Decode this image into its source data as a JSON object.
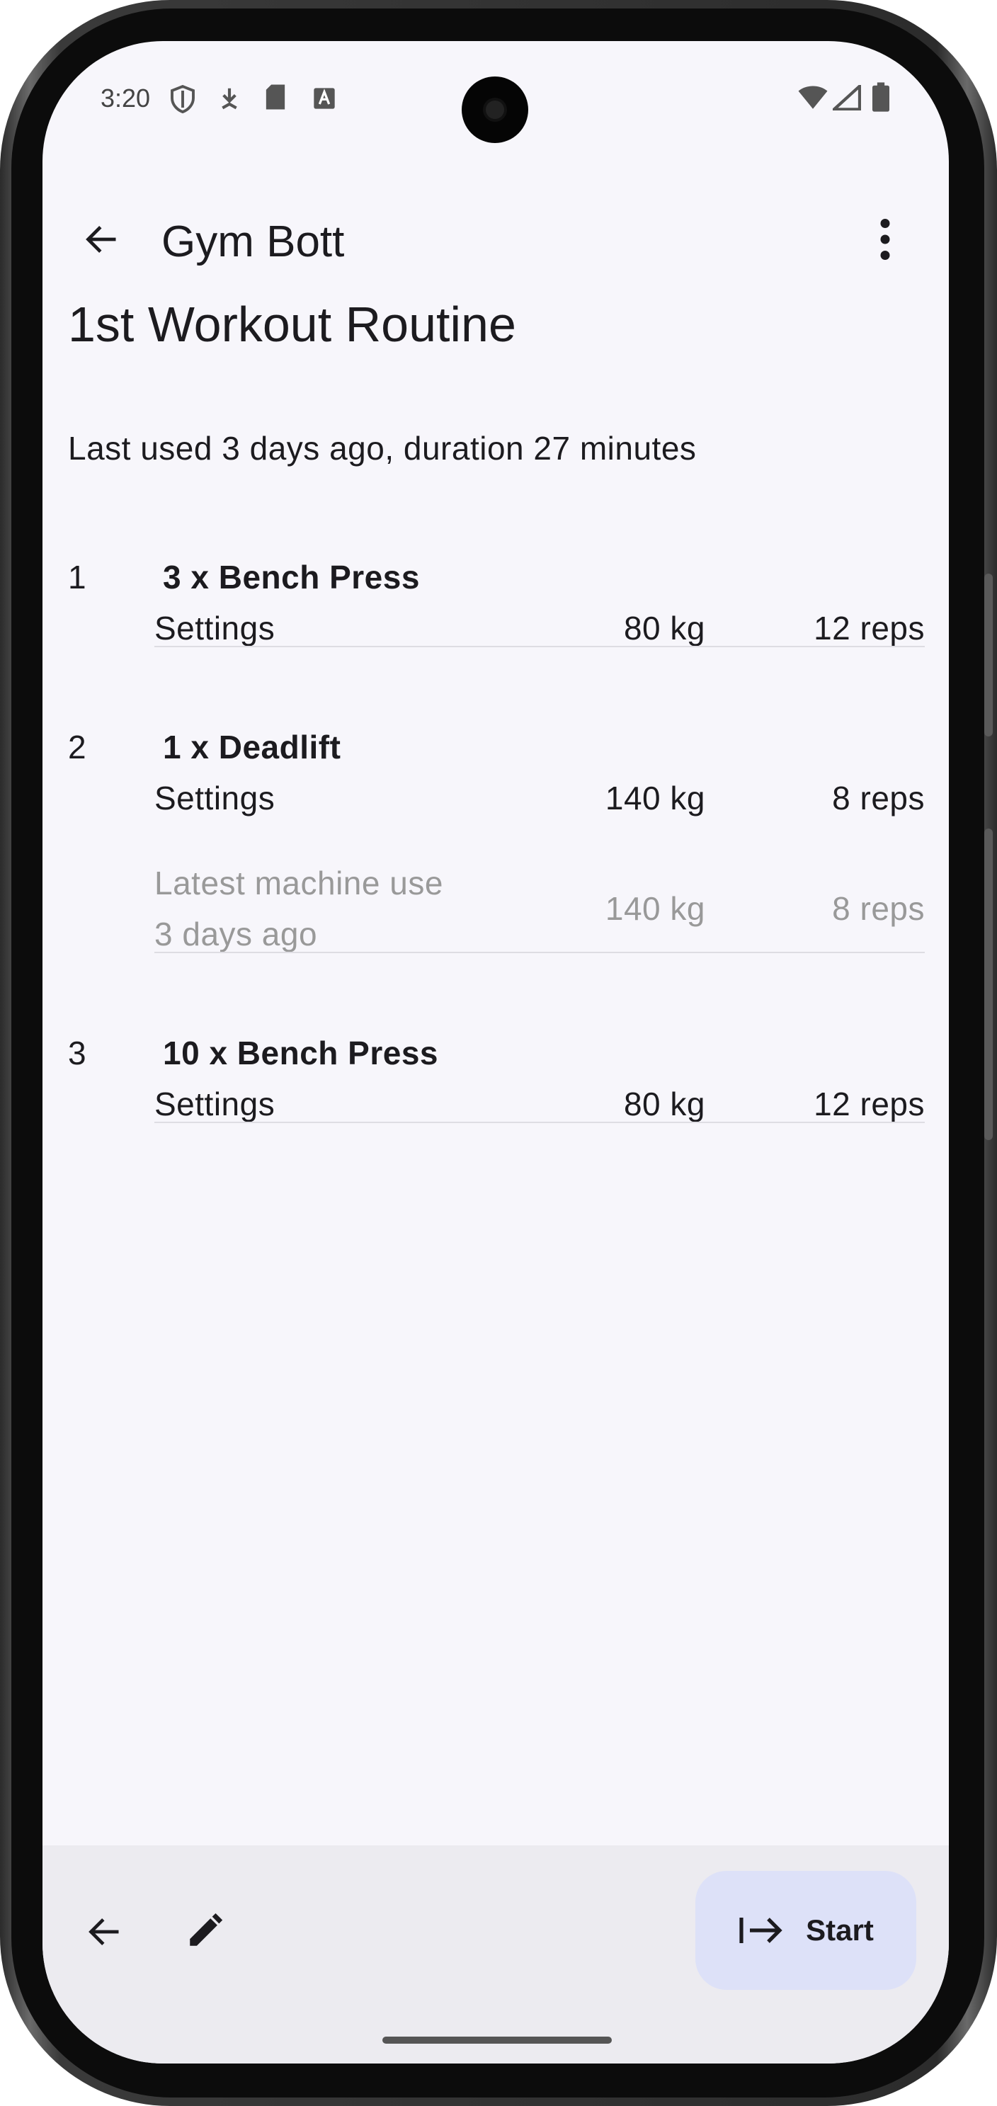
{
  "status_bar": {
    "time": "3:20",
    "left_icons": [
      "shield-icon",
      "download-icon",
      "sd-card-icon",
      "keyboard-a-icon"
    ],
    "right_icons": [
      "wifi-icon",
      "signal-icon",
      "battery-icon"
    ]
  },
  "app_bar": {
    "title": "Gym Bott",
    "back_icon": "arrow-back-icon",
    "menu_icon": "more-vert-icon"
  },
  "routine": {
    "title": "1st Workout Routine",
    "last_used": "Last used 3 days ago, duration 27 minutes"
  },
  "exercises": [
    {
      "number": "1",
      "name": "3 x Bench Press",
      "settings_label": "Settings",
      "weight": "80 kg",
      "reps": "12 reps"
    },
    {
      "number": "2",
      "name": "1 x Deadlift",
      "settings_label": "Settings",
      "weight": "140 kg",
      "reps": "8 reps",
      "latest_line1": "Latest machine use",
      "latest_line2": "3 days ago",
      "latest_weight": "140 kg",
      "latest_reps": "8 reps"
    },
    {
      "number": "3",
      "name": "10 x Bench Press",
      "settings_label": "Settings",
      "weight": "80 kg",
      "reps": "12 reps"
    }
  ],
  "bottom_bar": {
    "back_icon": "arrow-back-icon",
    "edit_icon": "pencil-icon",
    "start_icon": "start-arrow-icon",
    "start_label": "Start"
  },
  "colors": {
    "background": "#f7f6fb",
    "bottom_bar": "#ecebf0",
    "start_button": "#dde1f8",
    "text": "#1c1b1f",
    "muted_text": "#999999"
  }
}
